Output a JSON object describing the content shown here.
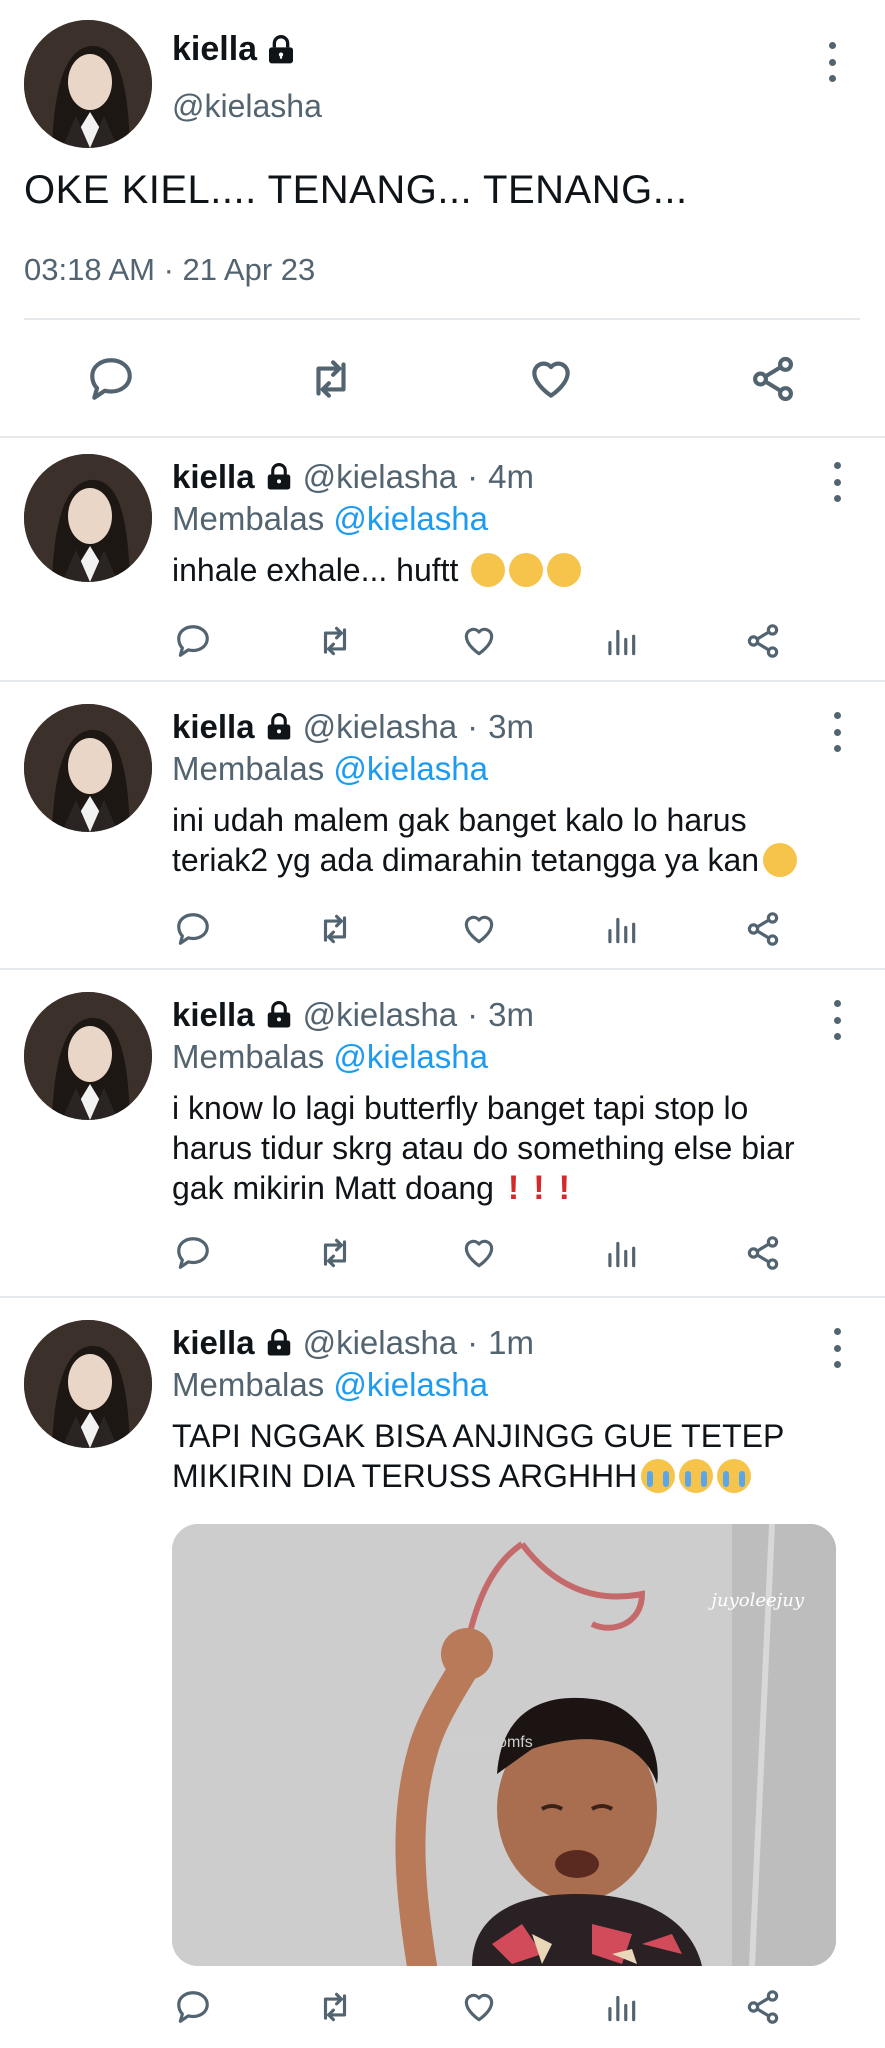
{
  "main_tweet": {
    "name": "kiella",
    "handle": "@kielasha",
    "text": "OKE KIEL.... TENANG... TENANG...",
    "timestamp": "03:18 AM · 21 Apr 23",
    "icons": [
      "reply-icon",
      "retweet-icon",
      "like-icon",
      "share-icon"
    ]
  },
  "replies": [
    {
      "name": "kiella",
      "handle": "@kielasha",
      "time": "4m",
      "replying_to_label": "Membalas",
      "replying_to": "@kielasha",
      "text": "inhale exhale... huftt",
      "emoji": [
        "exhale-face",
        "exhale-face",
        "exhale-face"
      ]
    },
    {
      "name": "kiella",
      "handle": "@kielasha",
      "time": "3m",
      "replying_to_label": "Membalas",
      "replying_to": "@kielasha",
      "text_line1": "ini udah malem gak banget kalo lo harus",
      "text_line2": "teriak2 yg ada dimarahin tetangga ya kan",
      "emoji": [
        "grinning-face"
      ]
    },
    {
      "name": "kiella",
      "handle": "@kielasha",
      "time": "3m",
      "replying_to_label": "Membalas",
      "replying_to": "@kielasha",
      "text_line1": "i know lo lagi butterfly banget tapi stop lo",
      "text_line2": "harus tidur skrg atau do something else biar",
      "text_line3": "gak mikirin Matt doang",
      "marks": [
        "!",
        "!",
        "!"
      ]
    },
    {
      "name": "kiella",
      "handle": "@kielasha",
      "time": "1m",
      "replying_to_label": "Membalas",
      "replying_to": "@kielasha",
      "text_line1": "TAPI NGGAK BISA ANJINGG GUE TETEP",
      "text_line2": "MIKIRIN DIA TERUSS ARGHHH",
      "emoji": [
        "crying-face",
        "crying-face",
        "crying-face"
      ],
      "media_credit": "juyoleejuy",
      "media_watermark": "@convomfs"
    }
  ]
}
